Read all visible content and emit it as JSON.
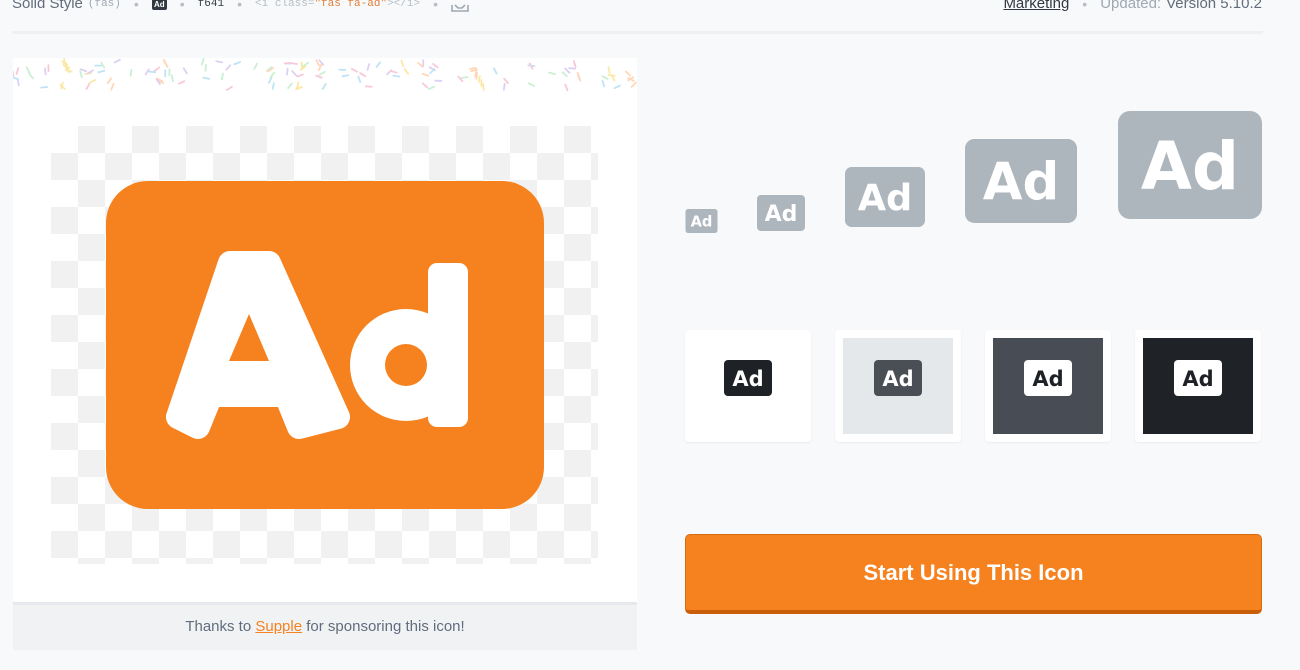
{
  "meta": {
    "style_name": "Solid Style",
    "style_code": "(fas)",
    "glyph_label": "Ad",
    "unicode": "f641",
    "markup_open": "<i class=",
    "markup_class": "\"fas fa-ad\"",
    "markup_close": "></i>",
    "download_icon": "tray-download-icon",
    "marketing": "Marketing",
    "updated_label": "Updated:",
    "updated_value": "Version 5.10.2"
  },
  "preview": {
    "icon_name": "ad-icon",
    "icon_color": "#f6821f",
    "sponsor_prefix": "Thanks to",
    "sponsor_link": "Supple",
    "sponsor_suffix": "for sponsoring this icon!"
  },
  "sizes": {
    "icon_color": "#adb5bd",
    "labels": [
      "Ad",
      "Ad",
      "Ad",
      "Ad",
      "Ad"
    ]
  },
  "swatches": [
    {
      "name": "white",
      "background": "#ffffff",
      "icon_color": "#1e2126",
      "glyph_color": "#ffffff"
    },
    {
      "name": "light",
      "background": "#e5e8eb",
      "icon_color": "#4a4f56",
      "glyph_color": "#ffffff"
    },
    {
      "name": "dark",
      "background": "#484c54",
      "icon_color": "#ffffff",
      "glyph_color": "#1e2126"
    },
    {
      "name": "darkest",
      "background": "#1f2226",
      "icon_color": "#ffffff",
      "glyph_color": "#1e2126"
    }
  ],
  "cta": {
    "label": "Start Using This Icon",
    "color": "#f6821f"
  }
}
